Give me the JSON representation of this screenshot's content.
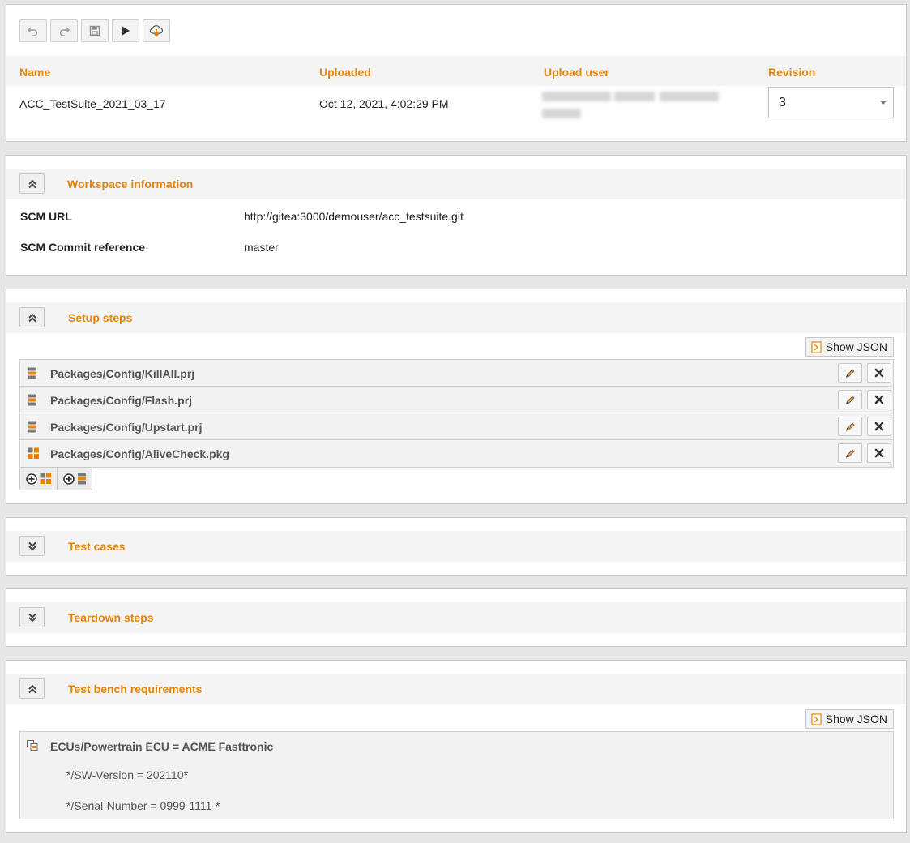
{
  "toolbar": {
    "undo_icon": "undo-icon",
    "redo_icon": "redo-icon",
    "save_icon": "save-icon",
    "run_icon": "play-icon",
    "download_icon": "cloud-download-icon"
  },
  "suite": {
    "headers": {
      "name": "Name",
      "uploaded": "Uploaded",
      "upload_user": "Upload user",
      "revision": "Revision"
    },
    "name": "ACC_TestSuite_2021_03_17",
    "uploaded": "Oct 12, 2021, 4:02:29 PM",
    "revision": "3"
  },
  "workspace": {
    "title": "Workspace information",
    "scm_url_label": "SCM URL",
    "scm_url": "http://gitea:3000/demouser/acc_testsuite.git",
    "commit_label": "SCM Commit reference",
    "commit": "master"
  },
  "setup": {
    "title": "Setup steps",
    "show_json": "Show JSON",
    "steps": [
      {
        "label": "Packages/Config/KillAll.prj",
        "icon": "project-icon"
      },
      {
        "label": "Packages/Config/Flash.prj",
        "icon": "project-icon"
      },
      {
        "label": "Packages/Config/Upstart.prj",
        "icon": "project-icon"
      },
      {
        "label": "Packages/Config/AliveCheck.pkg",
        "icon": "package-icon"
      }
    ]
  },
  "test_cases": {
    "title": "Test cases"
  },
  "teardown": {
    "title": "Teardown steps"
  },
  "requirements": {
    "title": "Test bench requirements",
    "show_json": "Show JSON",
    "item": "ECUs/Powertrain ECU = ACME Fasttronic",
    "attributes": [
      "*/SW-Version = 202110*",
      "*/Serial-Number = 0999-1111-*"
    ]
  },
  "colors": {
    "accent": "#e5850b",
    "panel_bg": "#ffffff",
    "page_bg": "#e6e6e6"
  }
}
